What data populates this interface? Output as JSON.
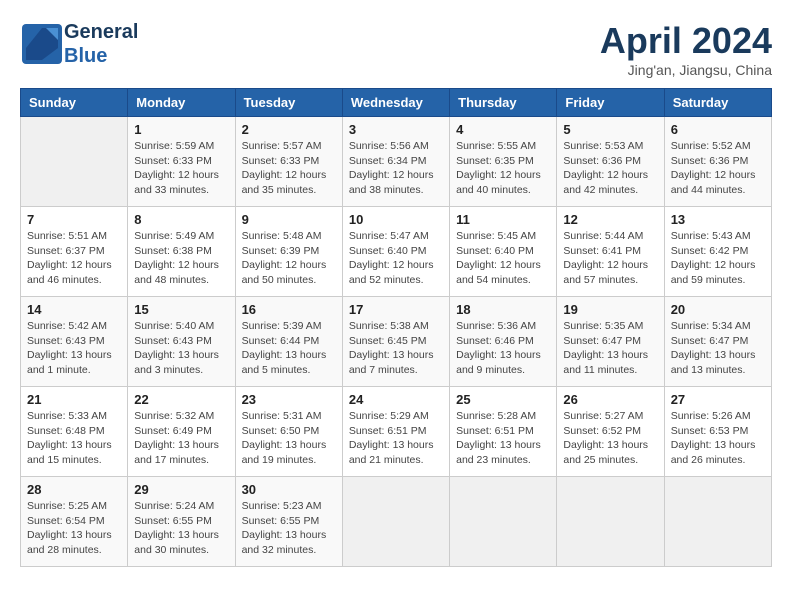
{
  "header": {
    "logo_line1": "General",
    "logo_line2": "Blue",
    "title": "April 2024",
    "location": "Jing'an, Jiangsu, China"
  },
  "weekdays": [
    "Sunday",
    "Monday",
    "Tuesday",
    "Wednesday",
    "Thursday",
    "Friday",
    "Saturday"
  ],
  "weeks": [
    [
      {
        "day": "",
        "sunrise": "",
        "sunset": "",
        "daylight": ""
      },
      {
        "day": "1",
        "sunrise": "Sunrise: 5:59 AM",
        "sunset": "Sunset: 6:33 PM",
        "daylight": "Daylight: 12 hours and 33 minutes."
      },
      {
        "day": "2",
        "sunrise": "Sunrise: 5:57 AM",
        "sunset": "Sunset: 6:33 PM",
        "daylight": "Daylight: 12 hours and 35 minutes."
      },
      {
        "day": "3",
        "sunrise": "Sunrise: 5:56 AM",
        "sunset": "Sunset: 6:34 PM",
        "daylight": "Daylight: 12 hours and 38 minutes."
      },
      {
        "day": "4",
        "sunrise": "Sunrise: 5:55 AM",
        "sunset": "Sunset: 6:35 PM",
        "daylight": "Daylight: 12 hours and 40 minutes."
      },
      {
        "day": "5",
        "sunrise": "Sunrise: 5:53 AM",
        "sunset": "Sunset: 6:36 PM",
        "daylight": "Daylight: 12 hours and 42 minutes."
      },
      {
        "day": "6",
        "sunrise": "Sunrise: 5:52 AM",
        "sunset": "Sunset: 6:36 PM",
        "daylight": "Daylight: 12 hours and 44 minutes."
      }
    ],
    [
      {
        "day": "7",
        "sunrise": "Sunrise: 5:51 AM",
        "sunset": "Sunset: 6:37 PM",
        "daylight": "Daylight: 12 hours and 46 minutes."
      },
      {
        "day": "8",
        "sunrise": "Sunrise: 5:49 AM",
        "sunset": "Sunset: 6:38 PM",
        "daylight": "Daylight: 12 hours and 48 minutes."
      },
      {
        "day": "9",
        "sunrise": "Sunrise: 5:48 AM",
        "sunset": "Sunset: 6:39 PM",
        "daylight": "Daylight: 12 hours and 50 minutes."
      },
      {
        "day": "10",
        "sunrise": "Sunrise: 5:47 AM",
        "sunset": "Sunset: 6:40 PM",
        "daylight": "Daylight: 12 hours and 52 minutes."
      },
      {
        "day": "11",
        "sunrise": "Sunrise: 5:45 AM",
        "sunset": "Sunset: 6:40 PM",
        "daylight": "Daylight: 12 hours and 54 minutes."
      },
      {
        "day": "12",
        "sunrise": "Sunrise: 5:44 AM",
        "sunset": "Sunset: 6:41 PM",
        "daylight": "Daylight: 12 hours and 57 minutes."
      },
      {
        "day": "13",
        "sunrise": "Sunrise: 5:43 AM",
        "sunset": "Sunset: 6:42 PM",
        "daylight": "Daylight: 12 hours and 59 minutes."
      }
    ],
    [
      {
        "day": "14",
        "sunrise": "Sunrise: 5:42 AM",
        "sunset": "Sunset: 6:43 PM",
        "daylight": "Daylight: 13 hours and 1 minute."
      },
      {
        "day": "15",
        "sunrise": "Sunrise: 5:40 AM",
        "sunset": "Sunset: 6:43 PM",
        "daylight": "Daylight: 13 hours and 3 minutes."
      },
      {
        "day": "16",
        "sunrise": "Sunrise: 5:39 AM",
        "sunset": "Sunset: 6:44 PM",
        "daylight": "Daylight: 13 hours and 5 minutes."
      },
      {
        "day": "17",
        "sunrise": "Sunrise: 5:38 AM",
        "sunset": "Sunset: 6:45 PM",
        "daylight": "Daylight: 13 hours and 7 minutes."
      },
      {
        "day": "18",
        "sunrise": "Sunrise: 5:36 AM",
        "sunset": "Sunset: 6:46 PM",
        "daylight": "Daylight: 13 hours and 9 minutes."
      },
      {
        "day": "19",
        "sunrise": "Sunrise: 5:35 AM",
        "sunset": "Sunset: 6:47 PM",
        "daylight": "Daylight: 13 hours and 11 minutes."
      },
      {
        "day": "20",
        "sunrise": "Sunrise: 5:34 AM",
        "sunset": "Sunset: 6:47 PM",
        "daylight": "Daylight: 13 hours and 13 minutes."
      }
    ],
    [
      {
        "day": "21",
        "sunrise": "Sunrise: 5:33 AM",
        "sunset": "Sunset: 6:48 PM",
        "daylight": "Daylight: 13 hours and 15 minutes."
      },
      {
        "day": "22",
        "sunrise": "Sunrise: 5:32 AM",
        "sunset": "Sunset: 6:49 PM",
        "daylight": "Daylight: 13 hours and 17 minutes."
      },
      {
        "day": "23",
        "sunrise": "Sunrise: 5:31 AM",
        "sunset": "Sunset: 6:50 PM",
        "daylight": "Daylight: 13 hours and 19 minutes."
      },
      {
        "day": "24",
        "sunrise": "Sunrise: 5:29 AM",
        "sunset": "Sunset: 6:51 PM",
        "daylight": "Daylight: 13 hours and 21 minutes."
      },
      {
        "day": "25",
        "sunrise": "Sunrise: 5:28 AM",
        "sunset": "Sunset: 6:51 PM",
        "daylight": "Daylight: 13 hours and 23 minutes."
      },
      {
        "day": "26",
        "sunrise": "Sunrise: 5:27 AM",
        "sunset": "Sunset: 6:52 PM",
        "daylight": "Daylight: 13 hours and 25 minutes."
      },
      {
        "day": "27",
        "sunrise": "Sunrise: 5:26 AM",
        "sunset": "Sunset: 6:53 PM",
        "daylight": "Daylight: 13 hours and 26 minutes."
      }
    ],
    [
      {
        "day": "28",
        "sunrise": "Sunrise: 5:25 AM",
        "sunset": "Sunset: 6:54 PM",
        "daylight": "Daylight: 13 hours and 28 minutes."
      },
      {
        "day": "29",
        "sunrise": "Sunrise: 5:24 AM",
        "sunset": "Sunset: 6:55 PM",
        "daylight": "Daylight: 13 hours and 30 minutes."
      },
      {
        "day": "30",
        "sunrise": "Sunrise: 5:23 AM",
        "sunset": "Sunset: 6:55 PM",
        "daylight": "Daylight: 13 hours and 32 minutes."
      },
      {
        "day": "",
        "sunrise": "",
        "sunset": "",
        "daylight": ""
      },
      {
        "day": "",
        "sunrise": "",
        "sunset": "",
        "daylight": ""
      },
      {
        "day": "",
        "sunrise": "",
        "sunset": "",
        "daylight": ""
      },
      {
        "day": "",
        "sunrise": "",
        "sunset": "",
        "daylight": ""
      }
    ]
  ]
}
